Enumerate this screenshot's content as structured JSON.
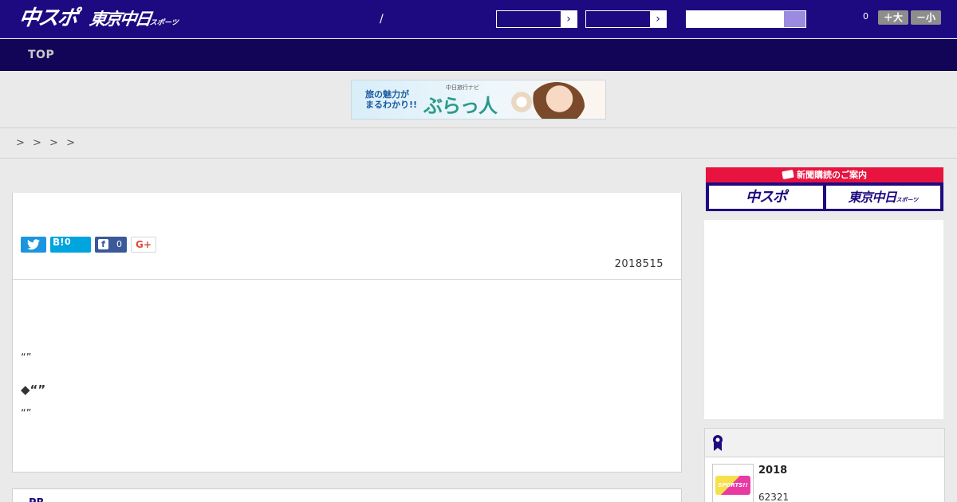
{
  "header": {
    "logo_main": "中スポ",
    "logo_tokyo": "東京中日",
    "logo_tokyo_suffix": "スポーツ",
    "slash": "/",
    "select_1": {
      "value": ""
    },
    "select_2": {
      "value": ""
    },
    "search": {
      "placeholder": "",
      "value": ""
    },
    "counter": "0",
    "font_larger": "＋大",
    "font_smaller": "－小"
  },
  "nav": {
    "items": [
      {
        "label": "TOP"
      }
    ]
  },
  "banner": {
    "line1": "旅の魅力が",
    "line2": "まるわかり!!",
    "subtitle": "中日旅行ナビ",
    "brand": "ぶらっ人"
  },
  "breadcrumb": {
    "text": "> > > >"
  },
  "article": {
    "share": {
      "twitter": "",
      "hatena": "B!",
      "hatena_count": "0",
      "facebook": "f",
      "facebook_count": "0",
      "google": "G+"
    },
    "date": "2018515",
    "lines": [
      "“”",
      "◆“”",
      "“”"
    ]
  },
  "article2": {
    "title": "PR"
  },
  "sidebar": {
    "subscribe": {
      "heading": "新聞購読のご案内",
      "btn1": "中スポ",
      "btn2": "東京中日",
      "btn2_suffix": "スポーツ"
    },
    "ranking": {
      "item_title": "2018",
      "item_sub": "62321",
      "thumb_text": "SPORTS!!"
    }
  },
  "colors": {
    "header": "#1d0a80",
    "nav": "#120558",
    "accent_red": "#e0242e",
    "accent_purple": "#7b66c8",
    "subscribe_red": "#e8133f"
  }
}
